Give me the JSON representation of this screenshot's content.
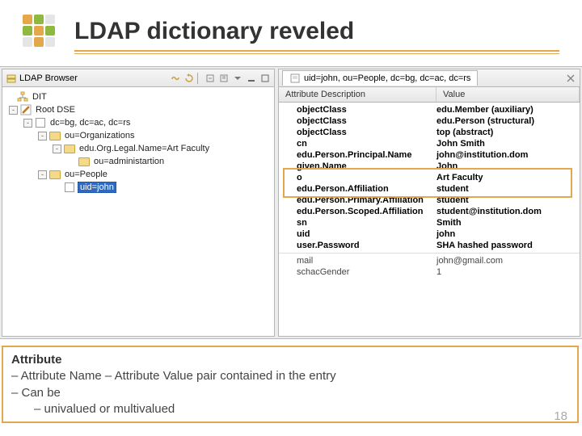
{
  "title": "LDAP dictionary reveled",
  "browser": {
    "pane_title": "LDAP Browser",
    "tree": {
      "root": "DIT",
      "rootdse": "Root DSE",
      "dc": "dc=bg, dc=ac, dc=rs",
      "orgs": "ou=Organizations",
      "artfac": "edu.Org.Legal.Name=Art Faculty",
      "admin": "ou=administartion",
      "people": "ou=People",
      "john": "uid=john"
    }
  },
  "editor": {
    "dn_tab": "uid=john, ou=People, dc=bg, dc=ac, dc=rs",
    "columns": {
      "attr": "Attribute Description",
      "value": "Value"
    },
    "rows": [
      {
        "a": "objectClass",
        "v": "edu.Member (auxiliary)"
      },
      {
        "a": "objectClass",
        "v": "edu.Person (structural)"
      },
      {
        "a": "objectClass",
        "v": "top (abstract)"
      },
      {
        "a": "cn",
        "v": "John Smith"
      },
      {
        "a": "edu.Person.Principal.Name",
        "v": "john@institution.dom"
      },
      {
        "a": "given.Name",
        "v": "John"
      },
      {
        "a": "o",
        "v": "Art Faculty"
      },
      {
        "a": "edu.Person.Affiliation",
        "v": "student"
      },
      {
        "a": "edu.Person.Primary.Affiliation",
        "v": "student"
      },
      {
        "a": "edu.Person.Scoped.Affiliation",
        "v": "student@institution.dom"
      },
      {
        "a": "sn",
        "v": "Smith"
      },
      {
        "a": "uid",
        "v": "john"
      },
      {
        "a": "user.Password",
        "v": "SHA hashed password"
      }
    ],
    "extra_rows": [
      {
        "a": "mail",
        "v": "john@gmail.com"
      },
      {
        "a": "schacGender",
        "v": "1"
      }
    ]
  },
  "note": {
    "heading": "Attribute",
    "line1": "– Attribute Name – Attribute Value pair contained in the entry",
    "line2": "– Can be",
    "line3": "– univalued or multivalued"
  },
  "page": "18"
}
